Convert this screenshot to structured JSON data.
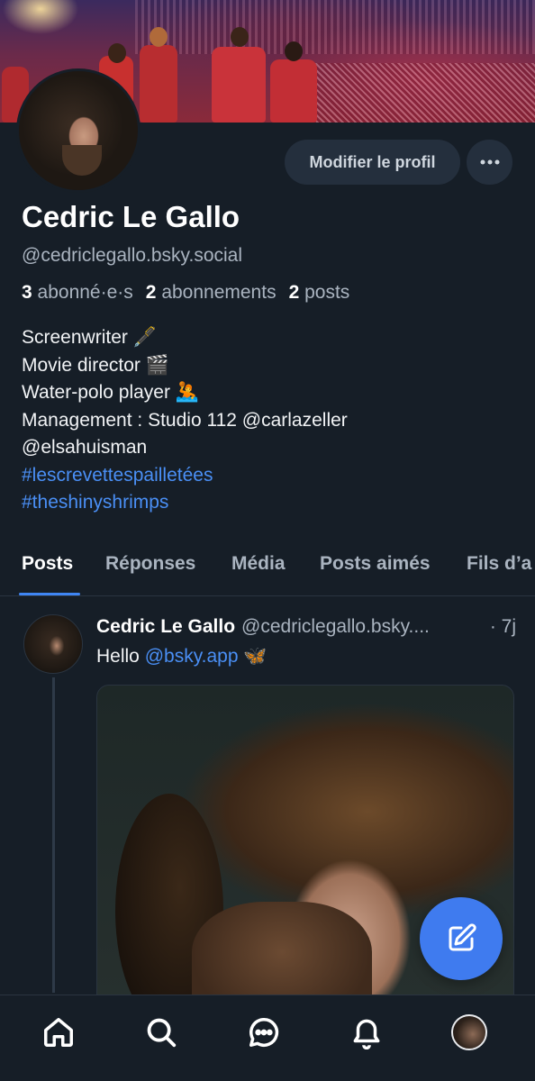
{
  "profile": {
    "display_name": "Cedric Le Gallo",
    "handle": "@cedriclegallo.bsky.social",
    "stats": {
      "followers_count": "3",
      "followers_label": "abonné·e·s",
      "following_count": "2",
      "following_label": "abonnements",
      "posts_count": "2",
      "posts_label": "posts"
    },
    "bio": {
      "line1": "Screenwriter 🖋️",
      "line2": "Movie director 🎬",
      "line3": "Water-polo player 🤽",
      "line4": "Management : Studio 112 @carlazeller",
      "line5": "@elsahuisman",
      "hashtag1": "#lescrevettespailletées",
      "hashtag2": "#theshinyshrimps"
    },
    "edit_button_label": "Modifier le profil"
  },
  "tabs": [
    {
      "label": "Posts",
      "active": true
    },
    {
      "label": "Réponses",
      "active": false
    },
    {
      "label": "Média",
      "active": false
    },
    {
      "label": "Posts aimés",
      "active": false
    },
    {
      "label": "Fils d’a",
      "active": false
    }
  ],
  "post": {
    "author": "Cedric Le Gallo",
    "handle": "@cedriclegallo.bsky....",
    "time": "· 7j",
    "text_prefix": "Hello ",
    "mention": "@bsky.app",
    "emoji": "🦋"
  },
  "icons": {
    "more": "more-horizontal-icon",
    "compose": "compose-icon",
    "home": "home-icon",
    "search": "search-icon",
    "chat": "chat-icon",
    "notifications": "bell-icon",
    "profile": "profile-avatar"
  },
  "colors": {
    "background": "#161e27",
    "accent": "#3f7bef",
    "link": "#4a8ff5",
    "secondary_text": "#aab4c0",
    "button_bg": "#242f3d"
  }
}
